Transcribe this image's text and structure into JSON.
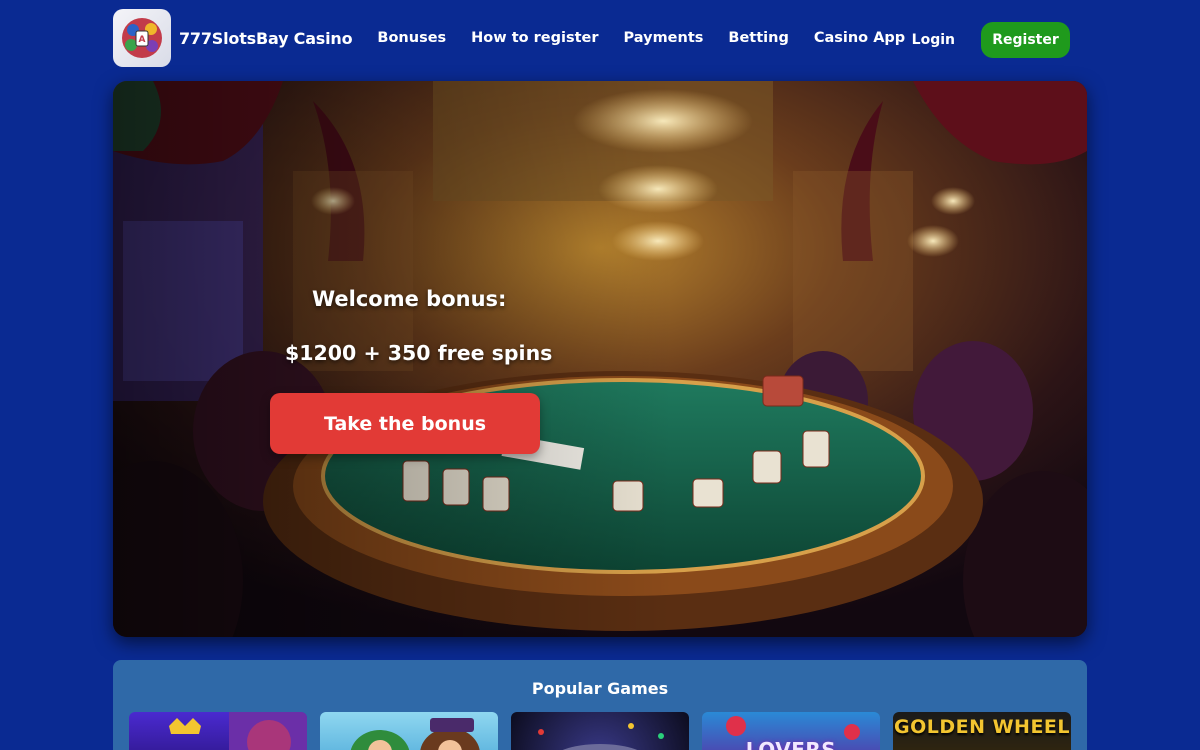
{
  "header": {
    "brand": "777SlotsBay Casino",
    "nav": [
      "Bonuses",
      "How to register",
      "Payments",
      "Betting",
      "Casino App"
    ],
    "login": "Login",
    "register": "Register"
  },
  "hero": {
    "title": "Welcome bonus:",
    "subtitle": "$1200 + 350 free spins",
    "cta": "Take the bonus"
  },
  "games": {
    "title": "Popular Games",
    "cards": [
      "",
      "",
      "",
      "LOVERS",
      "GOLDEN WHEEL"
    ]
  },
  "colors": {
    "page_bg": "#0a2a92",
    "register_btn": "#1f9a1c",
    "cta_btn": "#e23a36",
    "games_panel": "#2f69a8"
  },
  "icons": [
    "casino-logo-icon"
  ]
}
